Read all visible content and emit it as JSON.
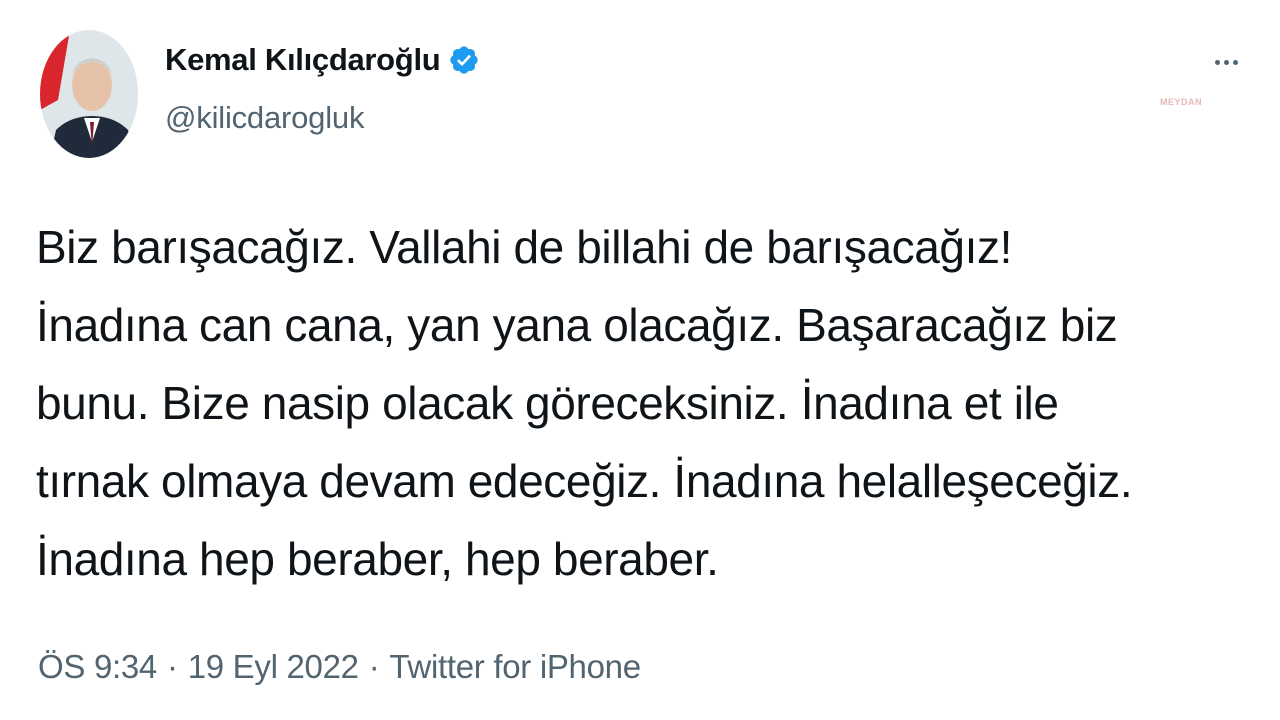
{
  "author": {
    "display_name": "Kemal Kılıçdaroğlu",
    "handle": "@kilicdarogluk",
    "verified": true,
    "avatar_icon": "profile-photo"
  },
  "watermark": "MEYDAN",
  "tweet": {
    "lines": [
      "Biz barışacağız. Vallahi de billahi de barışacağız!",
      "İnadına can cana, yan yana olacağız. Başaracağız biz",
      "bunu. Bize nasip olacak göreceksiniz. İnadına et ile",
      "tırnak olmaya devam edeceğiz. İnadına helalleşeceğiz.",
      "İnadına hep beraber, hep beraber."
    ]
  },
  "meta": {
    "time": "ÖS 9:34",
    "separator": "·",
    "date": "19 Eyl 2022",
    "source": "Twitter for iPhone"
  },
  "colors": {
    "text_primary": "#0f1419",
    "text_secondary": "#536471",
    "verified_blue": "#1d9bf0"
  }
}
